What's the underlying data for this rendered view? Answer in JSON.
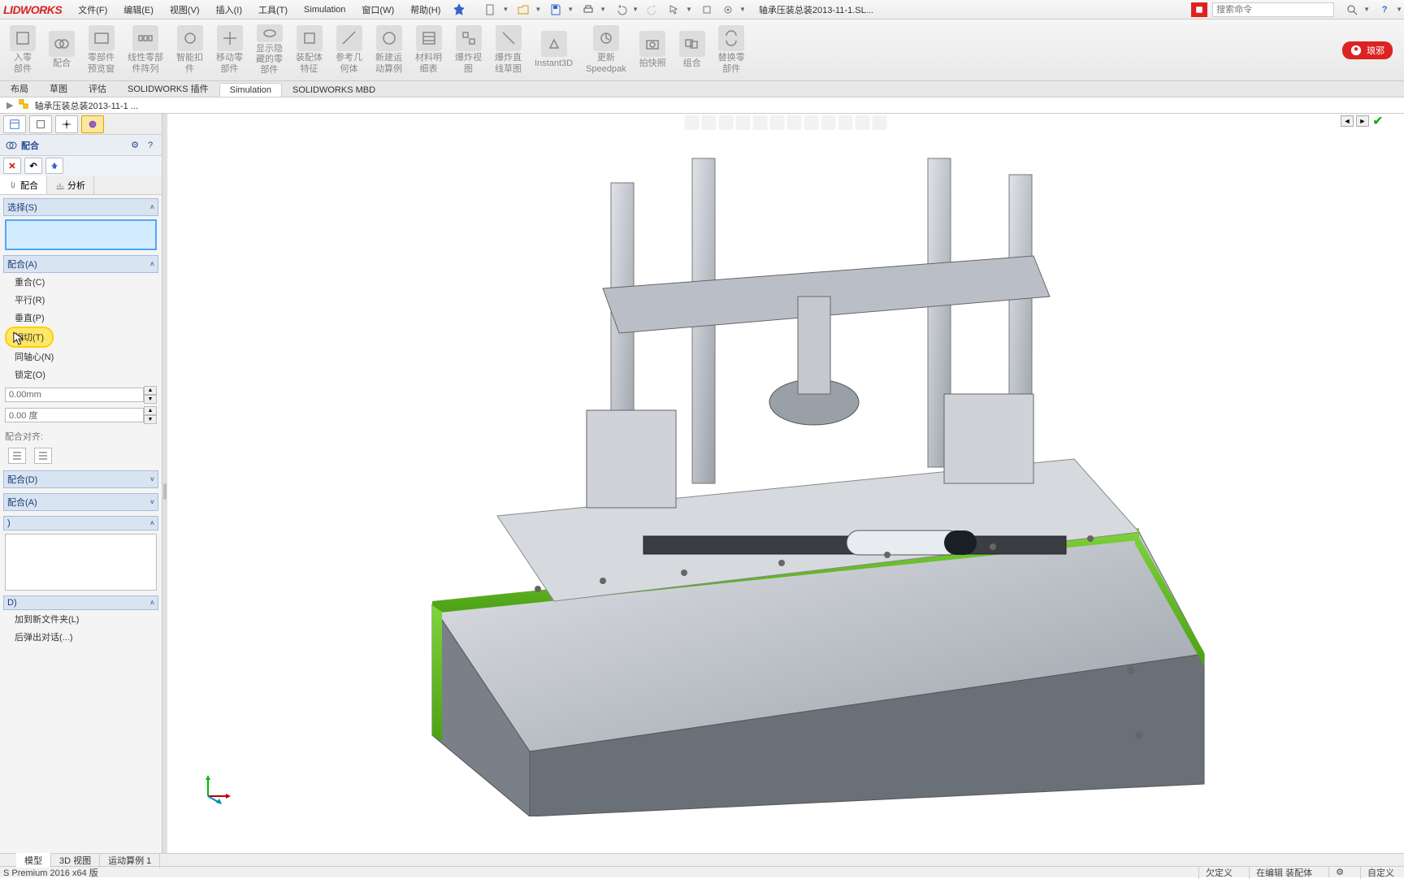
{
  "app": {
    "logo": "LIDWORKS"
  },
  "menu": {
    "file": "文件(F)",
    "edit": "编辑(E)",
    "view": "视图(V)",
    "insert": "插入(I)",
    "tools": "工具(T)",
    "simulation": "Simulation",
    "window": "窗口(W)",
    "help": "帮助(H)"
  },
  "doc": {
    "name": "轴承压装总装2013-11-1.SL..."
  },
  "search": {
    "placeholder": "搜索命令"
  },
  "ribbon": {
    "insert_part": "入零\n部件",
    "mate": "配合",
    "preview": "零部件\n预览窗",
    "linear": "线性零部\n件阵列",
    "smart": "智能扣\n件",
    "move": "移动零\n部件",
    "showhide": "显示隐\n藏的零\n部件",
    "assy_feat": "装配体\n特征",
    "refgeo": "参考几\n何体",
    "new_study": "新建运\n动算例",
    "bom": "材料明\n细表",
    "exploded": "爆炸视\n图",
    "expl_sketch": "爆炸直\n线草图",
    "instant3d": "Instant3D",
    "speedpak": "更新\nSpeedpak",
    "snapshot": "拍快照",
    "combine": "组合",
    "replace": "替换零\n部件",
    "user": "琅邪"
  },
  "cmd_tabs": {
    "layout": "布局",
    "sketch": "草图",
    "evaluate": "评估",
    "addins": "SOLIDWORKS 插件",
    "sim": "Simulation",
    "mbd": "SOLIDWORKS MBD"
  },
  "crumb": {
    "title": "轴承压装总装2013-11-1 ..."
  },
  "pm": {
    "title": "配合",
    "subtabs": {
      "mate": "配合",
      "analysis": "分析"
    },
    "sec_select": "选择(S)",
    "sec_mates": "配合(A)",
    "opt_coincident": "重合(C)",
    "opt_parallel": "平行(R)",
    "opt_perpendicular": "垂直(P)",
    "opt_tangent": "相切(T)",
    "opt_concentric": "同轴心(N)",
    "opt_lock": "锁定(O)",
    "dist_value": "0.00mm",
    "angle_value": "0.00 度",
    "align_label": "配合对齐:",
    "sec_adv": "配合(D)",
    "sec_mech": "配合(A)",
    "sec_opts": ")",
    "sec_newfolder": "加到新文件夹(L)",
    "sec_popup": "后弹出对话(...)",
    "sec_d": "D)"
  },
  "bottom_tabs": {
    "model": "模型",
    "view3d": "3D 视图",
    "motion": "运动算例 1"
  },
  "status": {
    "l": "S Premium 2016 x64 版",
    "r1": "欠定义",
    "r2": "在编辑 装配体",
    "r3": "自定义"
  }
}
